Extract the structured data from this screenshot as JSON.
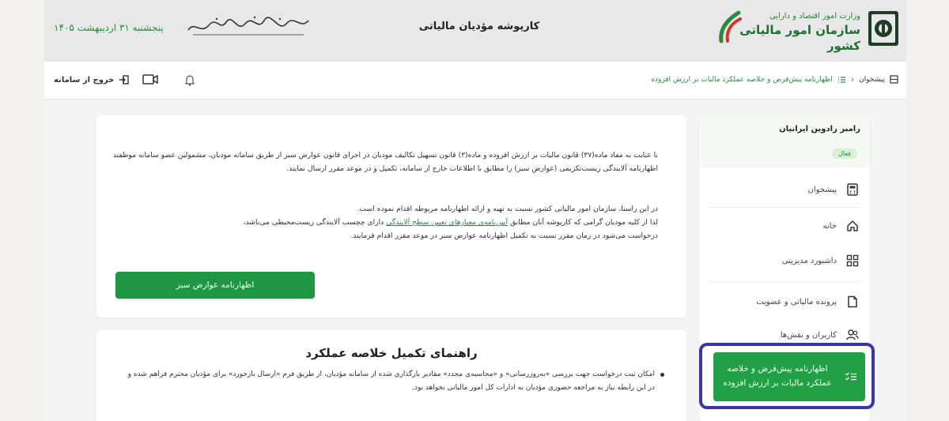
{
  "header": {
    "ministry": "وزارت امور اقتصاد و دارایی",
    "org": "سازمان امور مالیاتی کشور",
    "app_title": "کارپوشه مؤدیان مالیاتی",
    "date": "پنجشنبه ۳۱ اردیبهشت ۱۴۰۵"
  },
  "nav": {
    "logout_label": "خروج از سامانه",
    "breadcrumb": {
      "home": "پیشخوان",
      "current": "اظهارنامه پیش‌فرض و خلاصه عملکرد مالیات بر ارزش افزوده"
    }
  },
  "sidebar": {
    "user_name": "رامبر رادوین ایرانیان",
    "user_status": "فعال",
    "items": [
      {
        "label": "پیشخوان",
        "icon": "calculator-icon"
      },
      {
        "label": "خانه",
        "icon": "home-icon"
      },
      {
        "label": "داشبورد مدیریتی",
        "icon": "dashboard-icon"
      },
      {
        "label": "پرونده مالیاتی و عضویت",
        "icon": "file-icon"
      },
      {
        "label": "کاربران و نقش‌ها",
        "icon": "users-icon"
      }
    ],
    "active_item": "اظهارنامه پیش‌فرض و خلاصه عملکرد مالیات بر ارزش افزوده"
  },
  "notice": {
    "p1": "با عنایت به مفاد ماده(۳۷) قانون مالیات بر ارزش افزوده و ماده(۳) قانون تسهیل تکالیف مودیان در اجرای قانون عوارض سبز از طریق سامانه مودیان، مشمولین عضو سامانه موظفند اظهارنامه آلایندگی زیست‌تکزیمی (عوارض سبز) را مطابق با اطلاعات خارج از سامانه، تکمیل و در موعد مقرر ارسال نمایند.",
    "p2a": "در این راستا، سازمان امور مالیاتی کشور نسبت به تهیه و ارائه اظهارنامه مربوطه اقدام نموده است.",
    "p2b_before": "لذا از کلیه مودیان گرامی که کارپوشه آنان مطابق ",
    "p2b_link": "آیین‌نامه‌ی معیارهای تعیین سطح آلایندگی",
    "p2b_after": " دارای چچسب آلایندگی زیست‌محیطی می‌باشد،",
    "p2c": "درخواست می‌شود در زمان مقرر نسبت به تکمیل اظهارنامه عوارض سبز در موعد مقرر اقدام فرمایند.",
    "button_label": "اظهارنامه عوارض سبز"
  },
  "guide": {
    "title": "راهنمای تکمیل خلاصه عملکرد",
    "bullet": "امکان ثبت درخواست جهت بررسی «به‌روزرسانی» و «محاسبه‌ی مجدد» مقادیر بارگذاری شده از سامانه مؤدیان، از طریق فرم «ارسال بازخورد» برای مؤدیان محترم فراهم شده و در این رابطه نیاز به مراجعه حضوری مؤدیان به ادارات کل امور مالیاتی نخواهد بود."
  },
  "colors": {
    "brand_green": "#1f9643",
    "highlight_border": "#3b36a5"
  }
}
